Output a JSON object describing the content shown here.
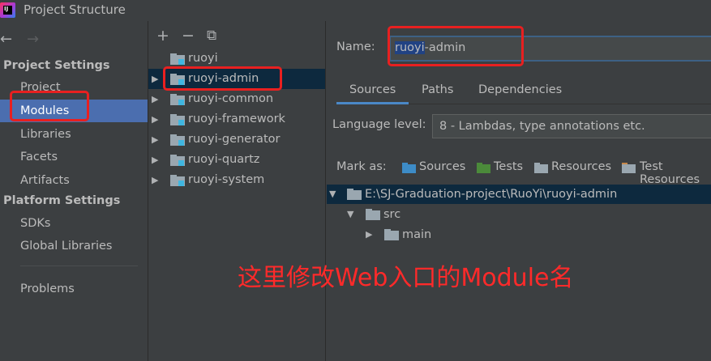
{
  "window": {
    "title": "Project Structure"
  },
  "left": {
    "nav_back": "←",
    "nav_forward": "→",
    "project_settings_header": "Project Settings",
    "project_items": [
      {
        "label": "Project"
      },
      {
        "label": "Modules",
        "selected": true
      },
      {
        "label": "Libraries"
      },
      {
        "label": "Facets"
      },
      {
        "label": "Artifacts"
      }
    ],
    "platform_settings_header": "Platform Settings",
    "platform_items": [
      {
        "label": "SDKs"
      },
      {
        "label": "Global Libraries"
      }
    ],
    "problems_label": "Problems"
  },
  "middle": {
    "toolbar": {
      "add": "+",
      "remove": "−",
      "copy": "⧉"
    },
    "modules": [
      {
        "label": "ruoyi",
        "expandable": false
      },
      {
        "label": "ruoyi-admin",
        "expandable": true,
        "selected": true
      },
      {
        "label": "ruoyi-common",
        "expandable": true
      },
      {
        "label": "ruoyi-framework",
        "expandable": true
      },
      {
        "label": "ruoyi-generator",
        "expandable": true
      },
      {
        "label": "ruoyi-quartz",
        "expandable": true
      },
      {
        "label": "ruoyi-system",
        "expandable": true
      }
    ]
  },
  "right": {
    "name_label": "Name:",
    "name_value_highlighted": "ruoyi",
    "name_value_rest": "-admin",
    "tabs": [
      {
        "label": "Sources",
        "active": true
      },
      {
        "label": "Paths"
      },
      {
        "label": "Dependencies"
      }
    ],
    "language_level_label": "Language level:",
    "language_level_value": "8 - Lambdas, type annotations etc.",
    "mark_as_label": "Mark as:",
    "mark_as": [
      {
        "label": "Sources",
        "color": "#3d8cc7"
      },
      {
        "label": "Tests",
        "color": "#4b8a3a"
      },
      {
        "label": "Resources",
        "color": "#9aa7b0"
      },
      {
        "label": "Test Resources",
        "color": "#c7884a"
      }
    ],
    "tree": [
      {
        "label": "E:\\SJ-Graduation-project\\RuoYi\\ruoyi-admin",
        "expanded": true
      },
      {
        "label": "src",
        "expanded": true
      },
      {
        "label": "main",
        "expanded": false
      }
    ]
  },
  "annotation": "这里修改Web入口的Module名",
  "colors": {
    "background": "#3c3f41",
    "selection": "#4b6eaf",
    "tree_selection": "#0d293e",
    "annotation": "#ff2a2a"
  }
}
